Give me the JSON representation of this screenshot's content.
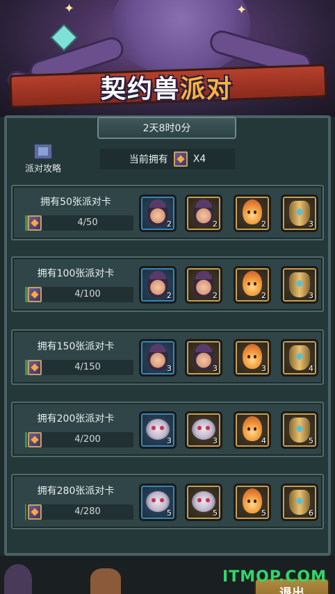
{
  "header": {
    "title_part1": "契约兽",
    "title_part2": "派对"
  },
  "timer": "2天8时0分",
  "guide_label": "派对攻略",
  "owned": {
    "prefix": "当前拥有",
    "count": "X4",
    "icon": "party-card-icon"
  },
  "tiers": [
    {
      "label": "拥有50张派对卡",
      "progress": "4/50",
      "fraction": 0.08,
      "rewards": [
        {
          "icon": "hero-portrait",
          "qty": "2",
          "frame": "blue"
        },
        {
          "icon": "hero-portrait",
          "qty": "2",
          "frame": "gold"
        },
        {
          "icon": "flame-spirit",
          "qty": "2",
          "frame": "gold"
        },
        {
          "icon": "golden-urn",
          "qty": "3",
          "frame": "gold"
        }
      ]
    },
    {
      "label": "拥有100张派对卡",
      "progress": "4/100",
      "fraction": 0.04,
      "rewards": [
        {
          "icon": "hero-portrait",
          "qty": "2",
          "frame": "blue"
        },
        {
          "icon": "hero-portrait",
          "qty": "2",
          "frame": "gold"
        },
        {
          "icon": "flame-spirit",
          "qty": "2",
          "frame": "gold"
        },
        {
          "icon": "golden-urn",
          "qty": "3",
          "frame": "gold"
        }
      ]
    },
    {
      "label": "拥有150张派对卡",
      "progress": "4/150",
      "fraction": 0.027,
      "rewards": [
        {
          "icon": "hero-portrait",
          "qty": "3",
          "frame": "blue"
        },
        {
          "icon": "hero-portrait",
          "qty": "3",
          "frame": "gold"
        },
        {
          "icon": "flame-spirit",
          "qty": "3",
          "frame": "gold"
        },
        {
          "icon": "golden-urn",
          "qty": "4",
          "frame": "gold"
        }
      ]
    },
    {
      "label": "拥有200张派对卡",
      "progress": "4/200",
      "fraction": 0.02,
      "rewards": [
        {
          "icon": "beast-portrait",
          "qty": "3",
          "frame": "blue"
        },
        {
          "icon": "beast-portrait",
          "qty": "3",
          "frame": "gold"
        },
        {
          "icon": "flame-spirit",
          "qty": "4",
          "frame": "gold"
        },
        {
          "icon": "golden-urn",
          "qty": "5",
          "frame": "gold"
        }
      ]
    },
    {
      "label": "拥有280张派对卡",
      "progress": "4/280",
      "fraction": 0.014,
      "rewards": [
        {
          "icon": "beast-portrait",
          "qty": "5",
          "frame": "blue"
        },
        {
          "icon": "beast-portrait",
          "qty": "5",
          "frame": "gold"
        },
        {
          "icon": "flame-spirit",
          "qty": "5",
          "frame": "gold"
        },
        {
          "icon": "golden-urn",
          "qty": "6",
          "frame": "gold"
        }
      ]
    }
  ],
  "exit_label": "退出",
  "watermark": "ITMOP.COM"
}
